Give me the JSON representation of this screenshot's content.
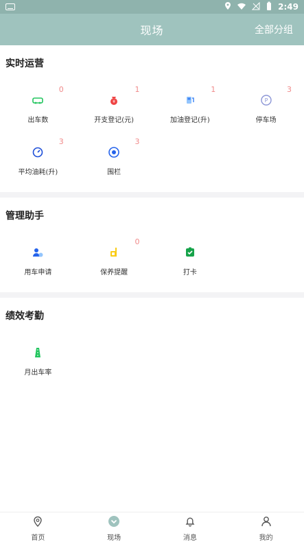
{
  "status_bar": {
    "time": "2:49"
  },
  "header": {
    "title": "现场",
    "right_action": "全部分组"
  },
  "sections": {
    "realtime": {
      "title": "实时运营",
      "items": [
        {
          "label": "出车数",
          "badge": "0",
          "icon": "car-icon"
        },
        {
          "label": "开支登记(元)",
          "badge": "1",
          "icon": "money-bag-icon"
        },
        {
          "label": "加油登记(升)",
          "badge": "1",
          "icon": "fuel-pump-icon"
        },
        {
          "label": "停车场",
          "badge": "3",
          "icon": "parking-icon"
        },
        {
          "label": "平均油耗(升)",
          "badge": "3",
          "icon": "gauge-icon"
        },
        {
          "label": "围栏",
          "badge": "3",
          "icon": "geofence-icon"
        }
      ]
    },
    "management": {
      "title": "管理助手",
      "items": [
        {
          "label": "用车申请",
          "badge": "",
          "icon": "user-car-request-icon"
        },
        {
          "label": "保养提醒",
          "badge": "0",
          "icon": "maintenance-icon"
        },
        {
          "label": "打卡",
          "badge": "",
          "icon": "check-in-icon"
        }
      ]
    },
    "performance": {
      "title": "绩效考勤",
      "items": [
        {
          "label": "月出车率",
          "badge": "",
          "icon": "road-icon"
        }
      ]
    }
  },
  "bottom_nav": [
    {
      "label": "首页",
      "icon": "location-pin-icon"
    },
    {
      "label": "现场",
      "icon": "chevron-down-circle-icon",
      "active": true
    },
    {
      "label": "消息",
      "icon": "bell-icon"
    },
    {
      "label": "我的",
      "icon": "user-icon"
    }
  ],
  "colors": {
    "header_bg": "#9fc3be",
    "status_bg": "#8fb3ad",
    "badge": "#f08a8a",
    "green": "#22c55e",
    "blue": "#3b82f6",
    "red": "#ef4444",
    "yellow": "#facc15"
  }
}
